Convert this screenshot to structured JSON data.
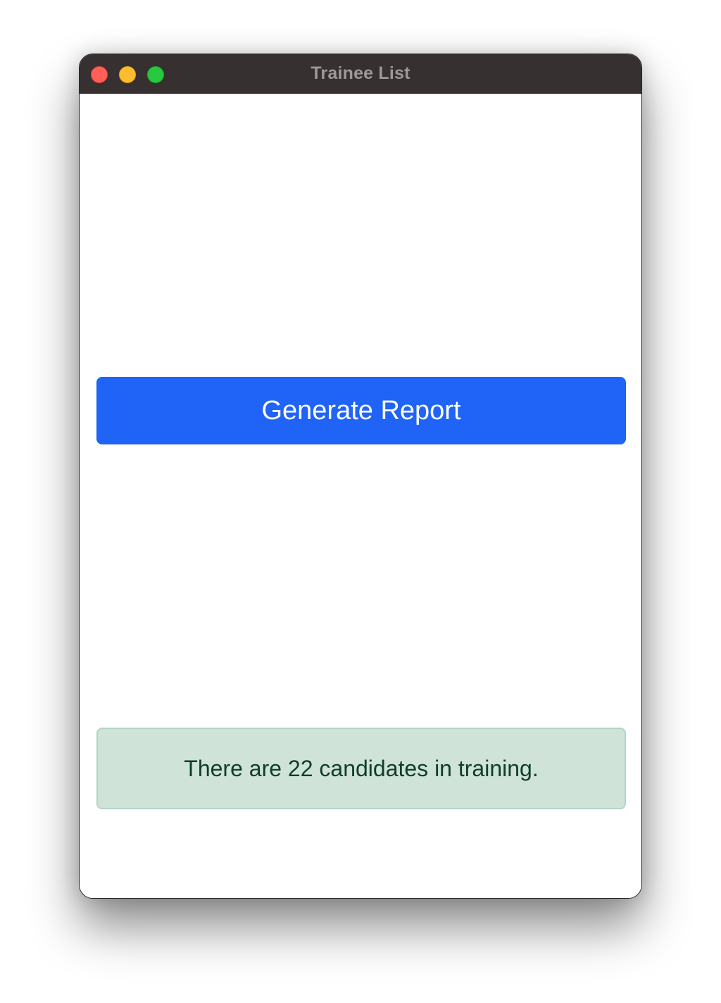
{
  "window": {
    "title": "Trainee List"
  },
  "controls": {
    "close": "close-icon",
    "minimize": "minimize-icon",
    "zoom": "zoom-icon"
  },
  "main": {
    "generate_button_label": "Generate Report",
    "status_message": "There are 22 candidates in training."
  },
  "colors": {
    "titlebar": "#373031",
    "primary": "#1f64f6",
    "alert_background": "#cfe3d8",
    "alert_text": "#103e26",
    "close": "#ff5f57",
    "minimize": "#febc2e",
    "zoom": "#28c840"
  }
}
